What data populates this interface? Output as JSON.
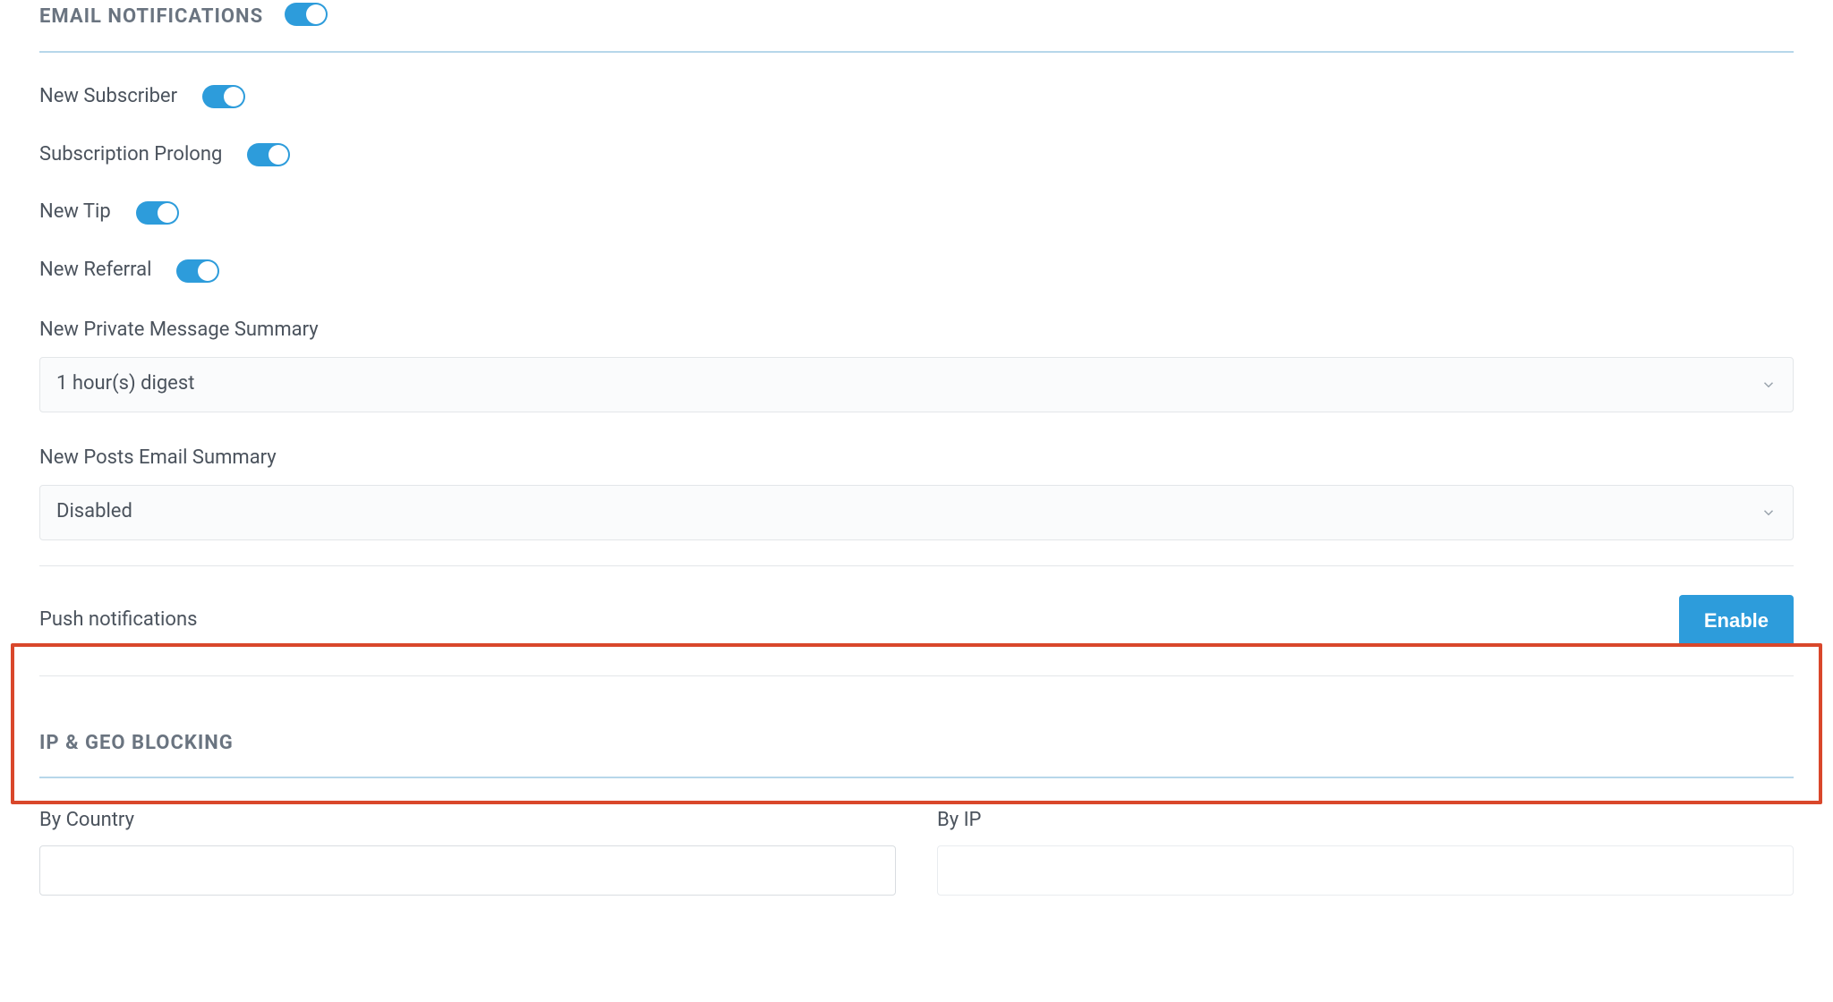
{
  "email": {
    "header": "EMAIL NOTIFICATIONS",
    "toggles": {
      "new_subscriber": "New Subscriber",
      "subscription_prolong": "Subscription Prolong",
      "new_tip": "New Tip",
      "new_referral": "New Referral"
    },
    "pm_summary": {
      "label": "New Private Message Summary",
      "value": "1 hour(s) digest"
    },
    "posts_summary": {
      "label": "New Posts Email Summary",
      "value": "Disabled"
    }
  },
  "push": {
    "label": "Push notifications",
    "button": "Enable"
  },
  "geo": {
    "header": "IP & GEO BLOCKING",
    "by_country": "By Country",
    "by_ip": "By IP"
  }
}
